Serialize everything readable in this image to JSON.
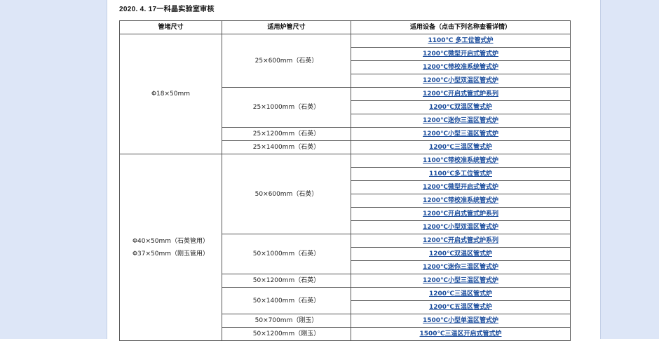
{
  "header": {
    "stamp": "2020. 4. 17一科晶实验室审核"
  },
  "table": {
    "headers": [
      "管堵尺寸",
      "适用炉管尺寸",
      "适用设备（点击下列名称查看详情）"
    ],
    "groups": [
      {
        "plug": [
          "Φ18×50mm"
        ],
        "tubes": [
          {
            "size": "25×600mm（石英）",
            "devices": [
              "1100℃ 多工位管式炉",
              "1200℃微型开启式管式炉",
              "1200℃带校准系统管式炉",
              "1200℃小型双温区管式炉"
            ]
          },
          {
            "size": "25×1000mm（石英）",
            "devices": [
              "1200℃开启式管式炉系列",
              "1200℃双温区管式炉",
              "1200℃迷你三温区管式炉"
            ]
          },
          {
            "size": "25×1200mm（石英）",
            "devices": [
              "1200℃小型三温区管式炉"
            ]
          },
          {
            "size": "25×1400mm（石英）",
            "devices": [
              "1200℃三温区管式炉"
            ]
          }
        ]
      },
      {
        "plug": [
          "Φ40×50mm（石英管用）",
          "Φ37×50mm（刚玉管用）"
        ],
        "tubes": [
          {
            "size": "50×600mm（石英）",
            "devices": [
              "1100℃带校准系统管式炉",
              "1100℃多工位管式炉",
              "1200℃微型开启式管式炉",
              "1200℃带校准系统管式炉",
              "1200℃开启式管式炉系列",
              "1200℃小型双温区管式炉"
            ]
          },
          {
            "size": "50×1000mm（石英）",
            "devices": [
              "1200℃开启式管式炉系列",
              "1200℃双温区管式炉",
              "1200℃迷你三温区管式炉"
            ]
          },
          {
            "size": "50×1200mm（石英）",
            "devices": [
              "1200℃小型三温区管式炉"
            ]
          },
          {
            "size": "50×1400mm（石英）",
            "devices": [
              "1200℃三温区管式炉",
              "1200℃五温区管式炉"
            ]
          },
          {
            "size": "50×700mm（刚玉）",
            "devices": [
              "1500℃小型单温区管式炉"
            ]
          },
          {
            "size": "50×1200mm（刚玉）",
            "devices": [
              "1500℃三温区开启式管式炉"
            ]
          }
        ]
      }
    ]
  }
}
